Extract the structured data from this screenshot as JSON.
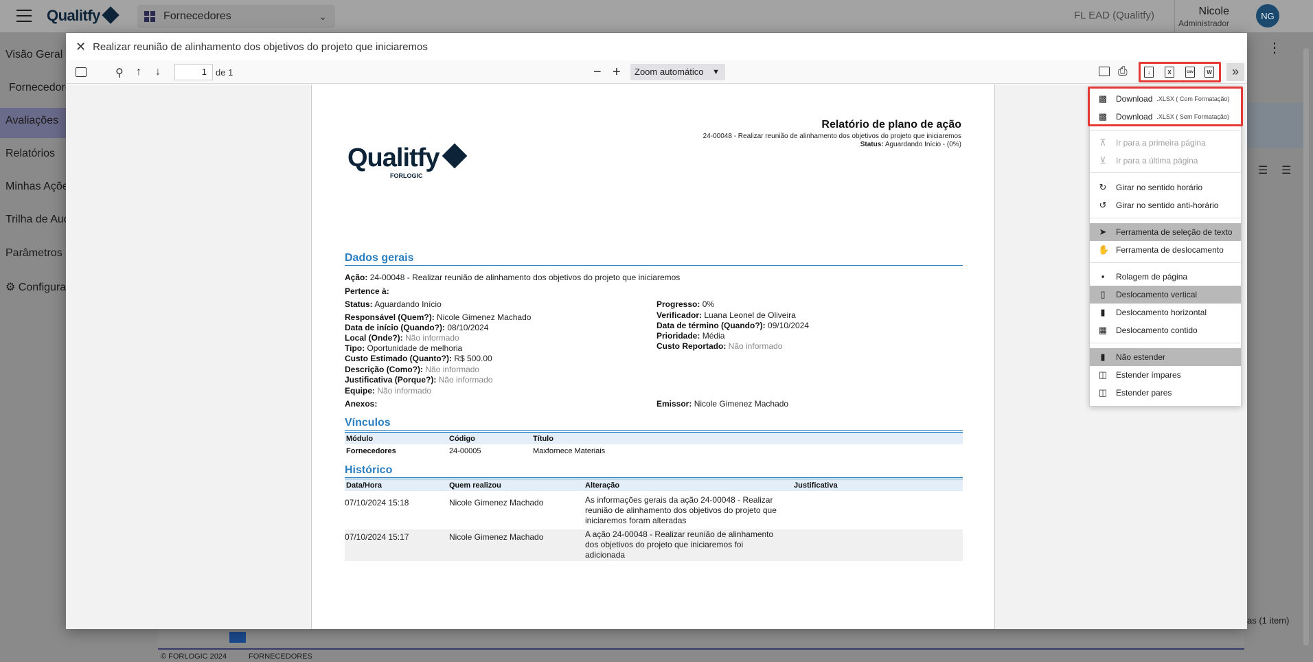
{
  "app": {
    "brand": "Qualitfy",
    "module": "Fornecedores",
    "org": "FL EAD (Qualitfy)"
  },
  "user": {
    "name": "Nicole",
    "role": "Administrador",
    "initials": "NG"
  },
  "sidebar": {
    "items": [
      {
        "label": "Visão Geral"
      },
      {
        "label": "Fornecedores"
      },
      {
        "label": "Avaliações"
      },
      {
        "label": "Relatórios"
      },
      {
        "label": "Minhas Ações"
      },
      {
        "label": "Trilha de Auditoria"
      },
      {
        "label": "Parâmetros"
      },
      {
        "label": "Configurações"
      }
    ]
  },
  "background": {
    "items_count": "as (1 item)",
    "footer_copy": "© FORLOGIC 2024",
    "footer_module": "FORNECEDORES"
  },
  "modal": {
    "title": "Realizar reunião de alinhamento dos objetivos do projeto que iniciaremos"
  },
  "pdf_toolbar": {
    "page_value": "1",
    "page_of": "de 1",
    "zoom": "Zoom automático"
  },
  "icons": {
    "sidebar_toggle": "sidebar-toggle-icon",
    "search": "search-icon",
    "prev": "arrow-up-icon",
    "next": "arrow-down-icon",
    "zoom_out": "minus-icon",
    "zoom_in": "plus-icon",
    "presentation": "presentation-icon",
    "print": "print-icon",
    "download_pdf": "download-pdf-icon",
    "download_xlsx": "download-xlsx-icon",
    "download_csv": "download-csv-icon",
    "download_word": "download-word-icon",
    "more_tools": "double-chevron-right-icon"
  },
  "icon_text": {
    "csv": "csv",
    "xlsx": "X",
    "word": "W"
  },
  "report": {
    "title": "Relatório de plano de ação",
    "subtitle": "24-00048 - Realizar reunião de alinhamento dos objetivos do projeto que iniciaremos",
    "status_label": "Status:",
    "status_value": "Aguardando Início - (0%)",
    "logo": "Qualitfy",
    "logo_sub": "FORLOGIC",
    "sections": {
      "general": "Dados gerais",
      "links": "Vínculos",
      "history": "Histórico"
    },
    "fields": {
      "acao_l": "Ação:",
      "acao_v": "24-00048 - Realizar reunião de alinhamento dos objetivos do projeto que iniciaremos",
      "pertence_l": "Pertence à:",
      "status_l": "Status:",
      "status_v": "Aguardando Início",
      "progresso_l": "Progresso:",
      "progresso_v": "0%",
      "resp_l": "Responsável (Quem?):",
      "resp_v": "Nicole Gimenez Machado",
      "verif_l": "Verificador:",
      "verif_v": "Luana Leonel de Oliveira",
      "inicio_l": "Data de início (Quando?):",
      "inicio_v": "08/10/2024",
      "termino_l": "Data de término (Quando?):",
      "termino_v": "09/10/2024",
      "local_l": "Local (Onde?):",
      "local_v": "Não informado",
      "prioridade_l": "Prioridade:",
      "prioridade_v": "Média",
      "tipo_l": "Tipo:",
      "tipo_v": "Oportunidade de melhoria",
      "custorep_l": "Custo Reportado:",
      "custorep_v": "Não informado",
      "custo_l": "Custo Estimado (Quanto?):",
      "custo_v": "R$ 500.00",
      "desc_l": "Descrição (Como?):",
      "desc_v": "Não informado",
      "just_l": "Justificativa (Porque?):",
      "just_v": "Não informado",
      "equipe_l": "Equipe:",
      "equipe_v": "Não informado",
      "anexos_l": "Anexos:",
      "emissor_l": "Emissor:",
      "emissor_v": "Nicole Gimenez Machado"
    },
    "links_table": {
      "headers": [
        "Módulo",
        "Código",
        "Título"
      ],
      "rows": [
        [
          "Fornecedores",
          "24-00005",
          "Maxfornece Materiais"
        ]
      ]
    },
    "history_table": {
      "headers": [
        "Data/Hora",
        "Quem realizou",
        "Alteração",
        "Justificativa"
      ],
      "rows": [
        {
          "date": "07/10/2024 15:18",
          "who": "Nicole Gimenez Machado",
          "change_lines": [
            "As informações gerais da ação 24-00048 - Realizar",
            "reunião de alinhamento dos objetivos do projeto que",
            "iniciaremos foram alteradas"
          ]
        },
        {
          "date": "07/10/2024 15:17",
          "who": "Nicole Gimenez Machado",
          "change_lines": [
            "A ação 24-00048 - Realizar reunião de alinhamento",
            "dos objetivos do projeto que iniciaremos foi",
            "adicionada"
          ]
        }
      ]
    }
  },
  "menu": {
    "download1": {
      "label": "Download",
      "detail": ".XLSX ( Com Formatação)"
    },
    "download2": {
      "label": "Download",
      "detail": ".XLSX ( Sem Formatação)"
    },
    "first_page": "Ir para a primeira página",
    "last_page": "Ir para a última página",
    "rotate_cw": "Girar no sentido horário",
    "rotate_ccw": "Girar no sentido anti-horário",
    "text_select": "Ferramenta de seleção de texto",
    "hand_tool": "Ferramenta de deslocamento",
    "page_scroll": "Rolagem de página",
    "vertical_scroll": "Deslocamento vertical",
    "horizontal_scroll": "Deslocamento horizontal",
    "wrapped_scroll": "Deslocamento contido",
    "no_spread": "Não estender",
    "odd_spread": "Estender ímpares",
    "even_spread": "Estender pares"
  },
  "colors": {
    "accent": "#2a7fc1",
    "highlight_box": "#e53935",
    "avatar": "#1c4a6e"
  }
}
